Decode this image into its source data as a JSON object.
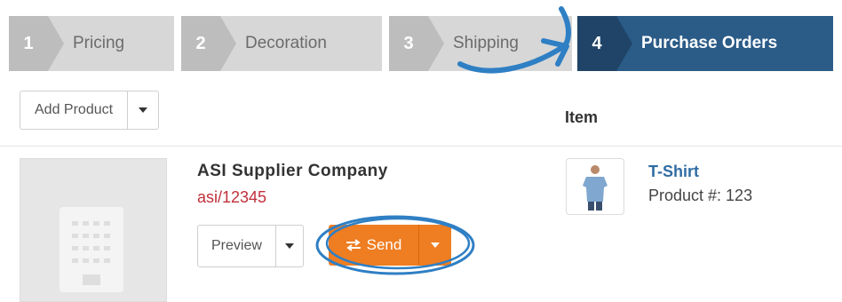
{
  "steps": [
    {
      "num": "1",
      "label": "Pricing"
    },
    {
      "num": "2",
      "label": "Decoration"
    },
    {
      "num": "3",
      "label": "Shipping"
    },
    {
      "num": "4",
      "label": "Purchase Orders"
    }
  ],
  "toolbar": {
    "add_product_label": "Add Product"
  },
  "table": {
    "item_header": "Item"
  },
  "supplier": {
    "name": "ASI Supplier Company",
    "id": "asi/12345"
  },
  "actions": {
    "preview_label": "Preview",
    "send_label": "Send"
  },
  "product": {
    "title": "T-Shirt",
    "number_text": "Product #: 123"
  },
  "colors": {
    "active_step": "#2b5b87",
    "send": "#ef7d21",
    "link": "#2f6da3",
    "supplier_id": "#c0303a",
    "annotation": "#2f7fc4"
  },
  "icons": {
    "send": "exchange-icon",
    "dropdown": "caret-down-icon",
    "placeholder": "building-icon"
  }
}
